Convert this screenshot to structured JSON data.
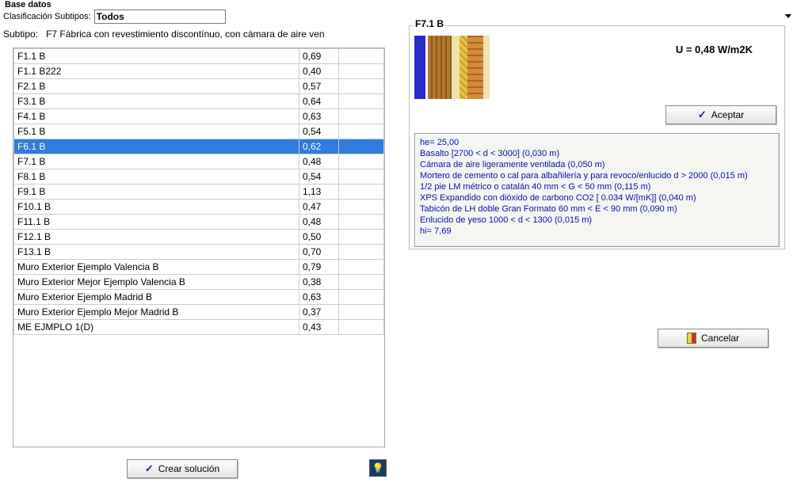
{
  "groupbox_title": "Base datos",
  "clasif_label": "Clasificación Subtipos:",
  "clasif_value": "Todos",
  "subtipo_prefix": "Subtipo:",
  "subtipo_text": "F7 Fábrica con revestimiento discontínuo, con cámara de aire ven",
  "selected_index": 6,
  "table": [
    {
      "name": "F1.1 B",
      "value": "0,69"
    },
    {
      "name": "F1.1 B222",
      "value": "0,40"
    },
    {
      "name": "F2.1 B",
      "value": "0,57"
    },
    {
      "name": "F3.1 B",
      "value": "0,64"
    },
    {
      "name": "F4.1 B",
      "value": "0,63"
    },
    {
      "name": "F5.1 B",
      "value": "0,54"
    },
    {
      "name": "F6.1 B",
      "value": "0,62"
    },
    {
      "name": "F7.1 B",
      "value": "0,48"
    },
    {
      "name": "F8.1 B",
      "value": "0,54"
    },
    {
      "name": "F9.1 B",
      "value": "1,13"
    },
    {
      "name": "F10.1 B",
      "value": "0,47"
    },
    {
      "name": "F11.1 B",
      "value": "0,48"
    },
    {
      "name": "F12.1 B",
      "value": "0,50"
    },
    {
      "name": "F13.1 B",
      "value": "0,70"
    },
    {
      "name": "Muro Exterior Ejemplo Valencia B",
      "value": "0,79"
    },
    {
      "name": "Muro Exterior Mejor Ejemplo Valencia B",
      "value": "0,38"
    },
    {
      "name": "Muro Exterior Ejemplo Madrid B",
      "value": "0,63"
    },
    {
      "name": "Muro Exterior Ejemplo Mejor Madrid B",
      "value": "0,37"
    },
    {
      "name": "ME EJMPLO 1(D)",
      "value": "0,43"
    }
  ],
  "crear_label": "Crear solución",
  "detail": {
    "title": "F7.1 B",
    "u_value": "U = 0,48 W/m2K",
    "aceptar_label": "Aceptar",
    "layers": [
      "he= 25,00",
      "Basalto [2700 < d < 3000] (0,030 m)",
      "Cámara de aire ligeramente ventilada (0,050 m)",
      "Mortero de cemento o cal para albañilería y para revoco/enlucido d > 2000 (0,015 m)",
      "1/2 pie LM métrico o catalán 40 mm < G < 50 mm (0,115 m)",
      "XPS Expandido con dióxido de carbono CO2 [ 0.034 W/[mK]] (0,040 m)",
      "Tabicón de LH doble Gran Formato 60 mm < E < 90 mm (0,090 m)",
      "Enlucido de yeso 1000 < d < 1300 (0,015 m)",
      "hi= 7,69"
    ]
  },
  "cancelar_label": "Cancelar"
}
